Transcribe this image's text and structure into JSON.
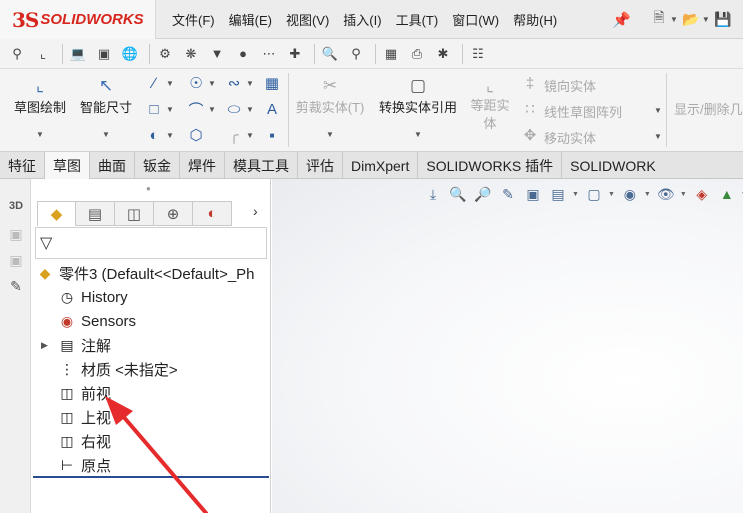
{
  "app": {
    "logo_prefix": "3S",
    "logo_text": "SOLIDWORKS"
  },
  "menu": [
    "文件(F)",
    "编辑(E)",
    "视图(V)",
    "插入(I)",
    "工具(T)",
    "窗口(W)",
    "帮助(H)"
  ],
  "ribbon": {
    "sketch": "草图绘制",
    "smart_dim": "智能尺寸",
    "trim": "剪裁实体(T)",
    "convert": "转换实体引用",
    "offset_line1": "等距实",
    "offset_line2": "体",
    "mirror": "镜向实体",
    "linear_pattern": "线性草图阵列",
    "move": "移动实体",
    "show_hide": "显示/删除几"
  },
  "tabs": [
    "特征",
    "草图",
    "曲面",
    "钣金",
    "焊件",
    "模具工具",
    "评估",
    "DimXpert",
    "SOLIDWORKS 插件",
    "SOLIDWORK"
  ],
  "active_tab": "草图",
  "tree": {
    "root": "零件3  (Default<<Default>_Ph",
    "history": "History",
    "sensors": "Sensors",
    "annotations": "注解",
    "material": "材质 <未指定>",
    "front": "前视",
    "top": "上视",
    "right": "右视",
    "origin": "原点"
  },
  "icons": {
    "root": "part-icon",
    "history": "history-icon",
    "sensors": "sensor-icon",
    "annotations": "annotation-icon",
    "material": "material-icon",
    "plane": "plane-icon",
    "origin": "origin-icon"
  },
  "colors": {
    "brand": "#d7261e",
    "annotation_arrow": "#e52b2b",
    "selection_line": "#274c8f"
  }
}
